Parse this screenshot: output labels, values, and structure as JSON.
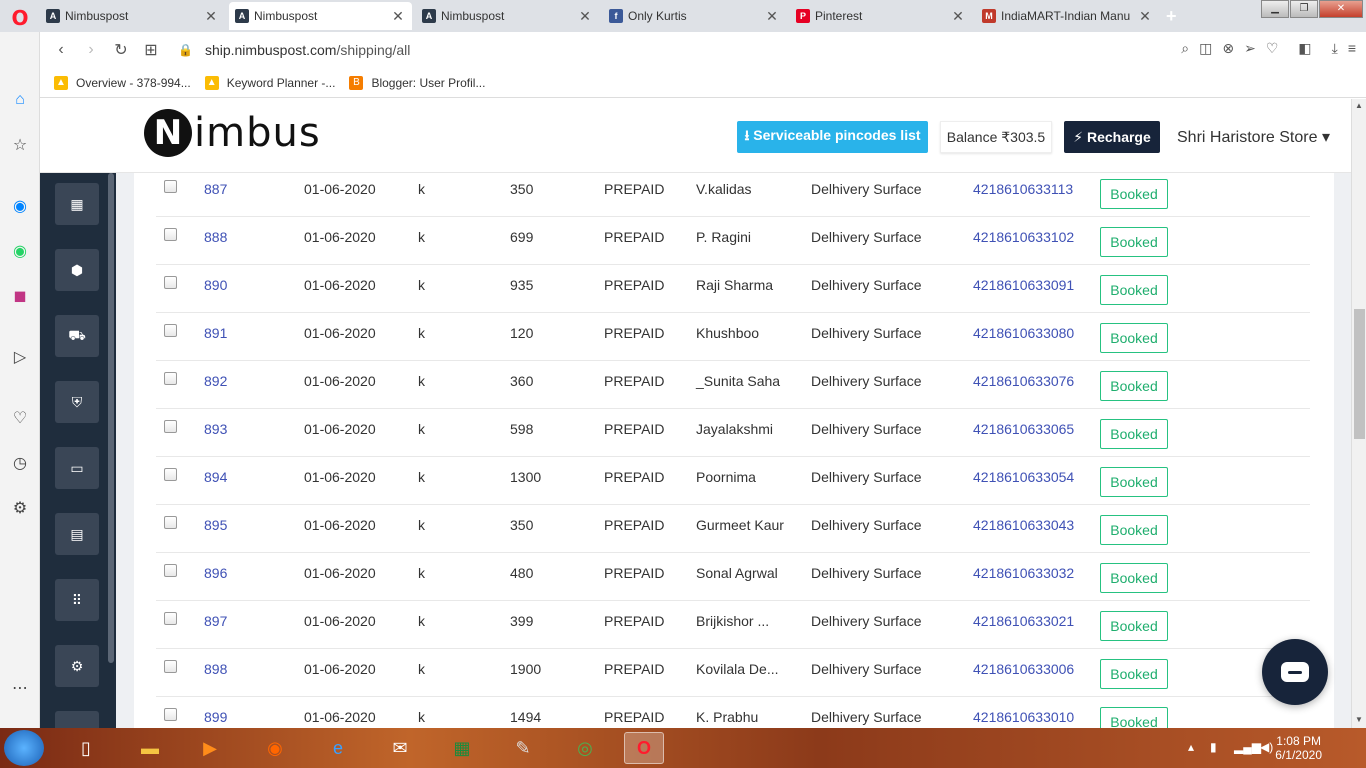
{
  "browser": {
    "tabs": [
      {
        "title": "Nimbuspost",
        "fav": "A",
        "fav_color": "#2d3a4a",
        "active": false
      },
      {
        "title": "Nimbuspost",
        "fav": "A",
        "fav_color": "#2d3a4a",
        "active": true
      },
      {
        "title": "Nimbuspost",
        "fav": "A",
        "fav_color": "#2d3a4a",
        "active": false
      },
      {
        "title": "Only Kurtis",
        "fav": "f",
        "fav_color": "#3b5998",
        "active": false
      },
      {
        "title": "Pinterest",
        "fav": "P",
        "fav_color": "#e60023",
        "active": false
      },
      {
        "title": "IndiaMART-Indian Manu",
        "fav": "M",
        "fav_color": "#c0392b",
        "active": false
      }
    ],
    "url_host": "ship.nimbuspost.com",
    "url_path": "/shipping/all",
    "bookmarks": [
      {
        "label": "Overview - 378-994...",
        "icon_color": "#fbbc04",
        "glyph": "▲"
      },
      {
        "label": "Keyword Planner -...",
        "icon_color": "#fbbc04",
        "glyph": "▲"
      },
      {
        "label": "Blogger: User Profil...",
        "icon_color": "#f57d00",
        "glyph": "B"
      }
    ]
  },
  "header": {
    "logo_mark": "N",
    "logo_word": "imbus",
    "pincode_button": "⭳ Serviceable pincodes list",
    "balance": "Balance ₹303.5",
    "recharge_button": "⚡ Recharge",
    "store": "Shri Haristore Store ▾"
  },
  "rows": [
    {
      "id": "887",
      "date": "01-06-2020",
      "product": "k",
      "amount": "350",
      "payment": "PREPAID",
      "customer": "V.kalidas",
      "courier": "Delhivery Surface",
      "awb": "4218610633113",
      "status": "Booked"
    },
    {
      "id": "888",
      "date": "01-06-2020",
      "product": "k",
      "amount": "699",
      "payment": "PREPAID",
      "customer": "P. Ragini",
      "courier": "Delhivery Surface",
      "awb": "4218610633102",
      "status": "Booked"
    },
    {
      "id": "890",
      "date": "01-06-2020",
      "product": "k",
      "amount": "935",
      "payment": "PREPAID",
      "customer": "Raji Sharma",
      "courier": "Delhivery Surface",
      "awb": "4218610633091",
      "status": "Booked"
    },
    {
      "id": "891",
      "date": "01-06-2020",
      "product": "k",
      "amount": "120",
      "payment": "PREPAID",
      "customer": "Khushboo",
      "courier": "Delhivery Surface",
      "awb": "4218610633080",
      "status": "Booked"
    },
    {
      "id": "892",
      "date": "01-06-2020",
      "product": "k",
      "amount": "360",
      "payment": "PREPAID",
      "customer": "_Sunita Saha",
      "courier": "Delhivery Surface",
      "awb": "4218610633076",
      "status": "Booked"
    },
    {
      "id": "893",
      "date": "01-06-2020",
      "product": "k",
      "amount": "598",
      "payment": "PREPAID",
      "customer": "Jayalakshmi",
      "courier": "Delhivery Surface",
      "awb": "4218610633065",
      "status": "Booked"
    },
    {
      "id": "894",
      "date": "01-06-2020",
      "product": "k",
      "amount": "1300",
      "payment": "PREPAID",
      "customer": "Poornima",
      "courier": "Delhivery Surface",
      "awb": "4218610633054",
      "status": "Booked"
    },
    {
      "id": "895",
      "date": "01-06-2020",
      "product": "k",
      "amount": "350",
      "payment": "PREPAID",
      "customer": "Gurmeet Kaur",
      "courier": "Delhivery Surface",
      "awb": "4218610633043",
      "status": "Booked"
    },
    {
      "id": "896",
      "date": "01-06-2020",
      "product": "k",
      "amount": "480",
      "payment": "PREPAID",
      "customer": "Sonal Agrwal",
      "courier": "Delhivery Surface",
      "awb": "4218610633032",
      "status": "Booked"
    },
    {
      "id": "897",
      "date": "01-06-2020",
      "product": "k",
      "amount": "399",
      "payment": "PREPAID",
      "customer": "Brijkishor ...",
      "courier": "Delhivery Surface",
      "awb": "4218610633021",
      "status": "Booked"
    },
    {
      "id": "898",
      "date": "01-06-2020",
      "product": "k",
      "amount": "1900",
      "payment": "PREPAID",
      "customer": "Kovilala De...",
      "courier": "Delhivery Surface",
      "awb": "4218610633006",
      "status": "Booked"
    },
    {
      "id": "899",
      "date": "01-06-2020",
      "product": "k",
      "amount": "1494",
      "payment": "PREPAID",
      "customer": "K. Prabhu",
      "courier": "Delhivery Surface",
      "awb": "4218610633010",
      "status": "Booked"
    }
  ],
  "taskbar": {
    "time": "1:08 PM",
    "date": "6/1/2020"
  },
  "colors": {
    "accent_blue": "#29b3ea",
    "dark_navy": "#17243a",
    "booked_green": "#26c281",
    "link": "#3f51b5"
  }
}
